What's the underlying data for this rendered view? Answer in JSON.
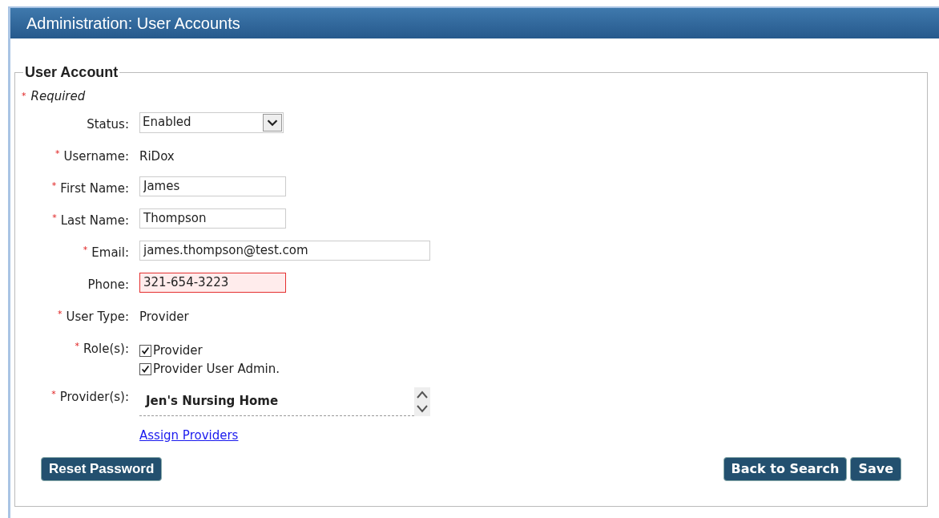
{
  "header": {
    "title": "Administration: User Accounts"
  },
  "form": {
    "legend": "User Account",
    "required_note": {
      "mark": "*",
      "text": "Required"
    },
    "fields": [
      {
        "kind": "select",
        "label": "Status:",
        "required": false,
        "value": "Enabled"
      },
      {
        "kind": "text",
        "label": "Username:",
        "required": true,
        "value": "RiDox"
      },
      {
        "kind": "input",
        "label": "First Name:",
        "required": true,
        "value": "James",
        "invalid": false
      },
      {
        "kind": "input",
        "label": "Last Name:",
        "required": true,
        "value": "Thompson",
        "invalid": false
      },
      {
        "kind": "wide_input",
        "label": "Email:",
        "required": true,
        "value": "james.thompson@test.com",
        "invalid": false
      },
      {
        "kind": "input",
        "label": "Phone:",
        "required": false,
        "value": "321-654-3223",
        "invalid": true
      },
      {
        "kind": "text",
        "label": "User Type:",
        "required": true,
        "value": "Provider"
      },
      {
        "kind": "checks",
        "label": "Role(s):",
        "required": true,
        "options": [
          {
            "label": "Provider",
            "checked": true
          },
          {
            "label": "Provider User Admin.",
            "checked": true
          }
        ]
      },
      {
        "kind": "list",
        "label": "Provider(s):",
        "required": true,
        "items": [
          "Jen's Nursing Home"
        ]
      }
    ],
    "link": "Assign Providers",
    "left_buttons": [
      "Reset Password"
    ],
    "right_buttons": [
      "Back to Search",
      "Save"
    ]
  }
}
